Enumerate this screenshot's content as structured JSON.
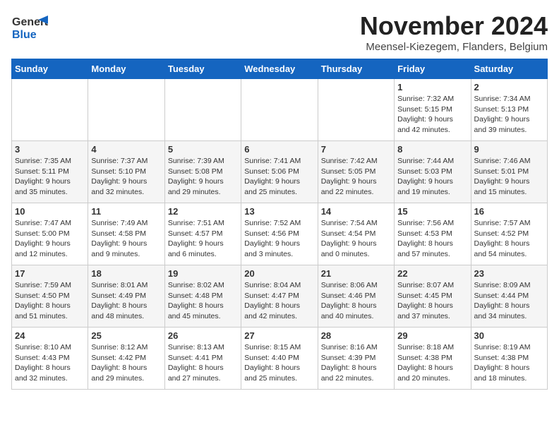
{
  "header": {
    "logo_line1": "General",
    "logo_line2": "Blue",
    "month": "November 2024",
    "location": "Meensel-Kiezegem, Flanders, Belgium"
  },
  "days_of_week": [
    "Sunday",
    "Monday",
    "Tuesday",
    "Wednesday",
    "Thursday",
    "Friday",
    "Saturday"
  ],
  "weeks": [
    [
      {
        "day": "",
        "info": ""
      },
      {
        "day": "",
        "info": ""
      },
      {
        "day": "",
        "info": ""
      },
      {
        "day": "",
        "info": ""
      },
      {
        "day": "",
        "info": ""
      },
      {
        "day": "1",
        "info": "Sunrise: 7:32 AM\nSunset: 5:15 PM\nDaylight: 9 hours\nand 42 minutes."
      },
      {
        "day": "2",
        "info": "Sunrise: 7:34 AM\nSunset: 5:13 PM\nDaylight: 9 hours\nand 39 minutes."
      }
    ],
    [
      {
        "day": "3",
        "info": "Sunrise: 7:35 AM\nSunset: 5:11 PM\nDaylight: 9 hours\nand 35 minutes."
      },
      {
        "day": "4",
        "info": "Sunrise: 7:37 AM\nSunset: 5:10 PM\nDaylight: 9 hours\nand 32 minutes."
      },
      {
        "day": "5",
        "info": "Sunrise: 7:39 AM\nSunset: 5:08 PM\nDaylight: 9 hours\nand 29 minutes."
      },
      {
        "day": "6",
        "info": "Sunrise: 7:41 AM\nSunset: 5:06 PM\nDaylight: 9 hours\nand 25 minutes."
      },
      {
        "day": "7",
        "info": "Sunrise: 7:42 AM\nSunset: 5:05 PM\nDaylight: 9 hours\nand 22 minutes."
      },
      {
        "day": "8",
        "info": "Sunrise: 7:44 AM\nSunset: 5:03 PM\nDaylight: 9 hours\nand 19 minutes."
      },
      {
        "day": "9",
        "info": "Sunrise: 7:46 AM\nSunset: 5:01 PM\nDaylight: 9 hours\nand 15 minutes."
      }
    ],
    [
      {
        "day": "10",
        "info": "Sunrise: 7:47 AM\nSunset: 5:00 PM\nDaylight: 9 hours\nand 12 minutes."
      },
      {
        "day": "11",
        "info": "Sunrise: 7:49 AM\nSunset: 4:58 PM\nDaylight: 9 hours\nand 9 minutes."
      },
      {
        "day": "12",
        "info": "Sunrise: 7:51 AM\nSunset: 4:57 PM\nDaylight: 9 hours\nand 6 minutes."
      },
      {
        "day": "13",
        "info": "Sunrise: 7:52 AM\nSunset: 4:56 PM\nDaylight: 9 hours\nand 3 minutes."
      },
      {
        "day": "14",
        "info": "Sunrise: 7:54 AM\nSunset: 4:54 PM\nDaylight: 9 hours\nand 0 minutes."
      },
      {
        "day": "15",
        "info": "Sunrise: 7:56 AM\nSunset: 4:53 PM\nDaylight: 8 hours\nand 57 minutes."
      },
      {
        "day": "16",
        "info": "Sunrise: 7:57 AM\nSunset: 4:52 PM\nDaylight: 8 hours\nand 54 minutes."
      }
    ],
    [
      {
        "day": "17",
        "info": "Sunrise: 7:59 AM\nSunset: 4:50 PM\nDaylight: 8 hours\nand 51 minutes."
      },
      {
        "day": "18",
        "info": "Sunrise: 8:01 AM\nSunset: 4:49 PM\nDaylight: 8 hours\nand 48 minutes."
      },
      {
        "day": "19",
        "info": "Sunrise: 8:02 AM\nSunset: 4:48 PM\nDaylight: 8 hours\nand 45 minutes."
      },
      {
        "day": "20",
        "info": "Sunrise: 8:04 AM\nSunset: 4:47 PM\nDaylight: 8 hours\nand 42 minutes."
      },
      {
        "day": "21",
        "info": "Sunrise: 8:06 AM\nSunset: 4:46 PM\nDaylight: 8 hours\nand 40 minutes."
      },
      {
        "day": "22",
        "info": "Sunrise: 8:07 AM\nSunset: 4:45 PM\nDaylight: 8 hours\nand 37 minutes."
      },
      {
        "day": "23",
        "info": "Sunrise: 8:09 AM\nSunset: 4:44 PM\nDaylight: 8 hours\nand 34 minutes."
      }
    ],
    [
      {
        "day": "24",
        "info": "Sunrise: 8:10 AM\nSunset: 4:43 PM\nDaylight: 8 hours\nand 32 minutes."
      },
      {
        "day": "25",
        "info": "Sunrise: 8:12 AM\nSunset: 4:42 PM\nDaylight: 8 hours\nand 29 minutes."
      },
      {
        "day": "26",
        "info": "Sunrise: 8:13 AM\nSunset: 4:41 PM\nDaylight: 8 hours\nand 27 minutes."
      },
      {
        "day": "27",
        "info": "Sunrise: 8:15 AM\nSunset: 4:40 PM\nDaylight: 8 hours\nand 25 minutes."
      },
      {
        "day": "28",
        "info": "Sunrise: 8:16 AM\nSunset: 4:39 PM\nDaylight: 8 hours\nand 22 minutes."
      },
      {
        "day": "29",
        "info": "Sunrise: 8:18 AM\nSunset: 4:38 PM\nDaylight: 8 hours\nand 20 minutes."
      },
      {
        "day": "30",
        "info": "Sunrise: 8:19 AM\nSunset: 4:38 PM\nDaylight: 8 hours\nand 18 minutes."
      }
    ]
  ]
}
